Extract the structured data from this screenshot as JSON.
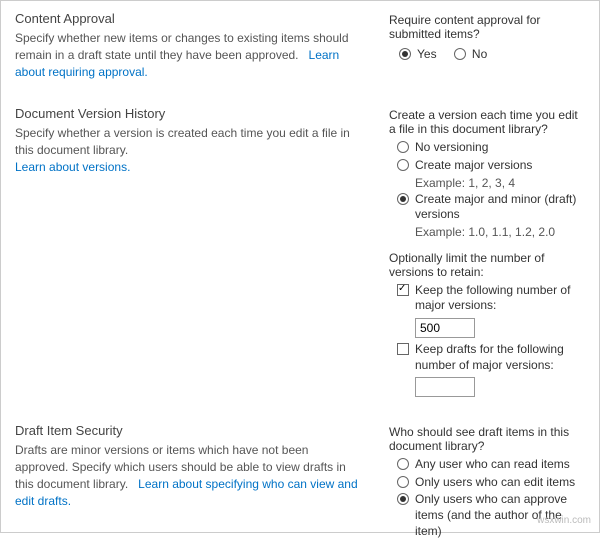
{
  "watermark": "wsxwin.com",
  "contentApproval": {
    "title": "Content Approval",
    "desc": "Specify whether new items or changes to existing items should remain in a draft state until they have been approved.",
    "link": "Learn about requiring approval.",
    "question": "Require content approval for submitted items?",
    "yes": "Yes",
    "no": "No"
  },
  "versionHistory": {
    "title": "Document Version History",
    "desc": "Specify whether a version is created each time you edit a file in this document library.",
    "link": "Learn about versions.",
    "question": "Create a version each time you edit a file in this document library?",
    "optNone": "No versioning",
    "optMajor": "Create major versions",
    "exMajor": "Example: 1, 2, 3, 4",
    "optMajorMinor": "Create major and minor (draft) versions",
    "exMajorMinor": "Example: 1.0, 1.1, 1.2, 2.0",
    "limitQuestion": "Optionally limit the number of versions to retain:",
    "keepMajor": "Keep the following number of major versions:",
    "keepMajorValue": "500",
    "keepDrafts": "Keep drafts for the following number of major versions:",
    "keepDraftsValue": ""
  },
  "draftSecurity": {
    "title": "Draft Item Security",
    "desc": "Drafts are minor versions or items which have not been approved. Specify which users should be able to view drafts in this document library.",
    "link": "Learn about specifying who can view and edit drafts.",
    "question": "Who should see draft items in this document library?",
    "optRead": "Any user who can read items",
    "optEdit": "Only users who can edit items",
    "optApprove": "Only users who can approve items (and the author of the item)"
  }
}
